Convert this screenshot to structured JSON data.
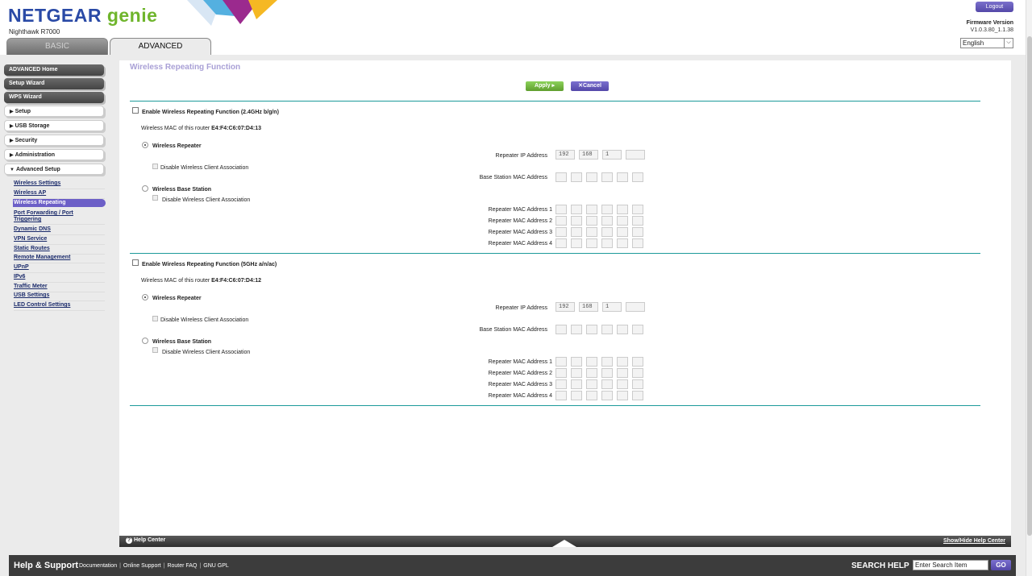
{
  "header": {
    "logo_brand": "NETGEAR",
    "logo_product": "genie",
    "model": "Nighthawk R7000",
    "tabs": {
      "basic": "BASIC",
      "advanced": "ADVANCED"
    },
    "logout_label": "Logout",
    "firmware_label": "Firmware Version",
    "firmware_value": "V1.0.3.80_1.1.38",
    "language_selected": "English"
  },
  "sidebar": {
    "buttons": {
      "advanced_home": "ADVANCED Home",
      "setup_wizard": "Setup Wizard",
      "wps_wizard": "WPS Wizard"
    },
    "sections": {
      "setup": "Setup",
      "usb_storage": "USB Storage",
      "security": "Security",
      "administration": "Administration",
      "advanced_setup": "Advanced Setup"
    },
    "sub_items": {
      "wireless_settings": "Wireless Settings",
      "wireless_ap": "Wireless AP",
      "wireless_repeating": "Wireless Repeating",
      "port_forwarding_1": "Port Forwarding / Port",
      "port_forwarding_2": "Triggering",
      "dynamic_dns": "Dynamic DNS",
      "vpn_service": "VPN Service",
      "static_routes": "Static Routes",
      "remote_management": "Remote Management",
      "upnp": "UPnP",
      "ipv6": "IPv6",
      "traffic_meter": "Traffic Meter",
      "usb_settings": "USB Settings",
      "led_control": "LED Control Settings"
    }
  },
  "main": {
    "title": "Wireless Repeating Function",
    "apply_label": "Apply",
    "apply_arrow": "▸",
    "cancel_icon": "✕",
    "cancel_label": "Cancel",
    "band24": {
      "enable_label": "Enable Wireless Repeating Function (2.4GHz b/g/n)",
      "mac_label": "Wireless MAC of this router",
      "mac_value": "E4:F4:C6:07:D4:13",
      "repeater_label": "Wireless Repeater",
      "disable_assoc_label": "Disable Wireless Client Association",
      "base_station_label": "Wireless Base Station",
      "disable_assoc_label2": "Disable Wireless Client Association",
      "repeater_ip_label": "Repeater IP Address",
      "ip": [
        "192",
        "168",
        "1",
        ""
      ],
      "base_mac_label": "Base Station MAC Address",
      "rep_mac_labels": [
        "Repeater MAC Address 1",
        "Repeater MAC Address 2",
        "Repeater MAC Address 3",
        "Repeater MAC Address 4"
      ]
    },
    "band5": {
      "enable_label": "Enable Wireless Repeating Function (5GHz a/n/ac)",
      "mac_label": "Wireless MAC of this router",
      "mac_value": "E4:F4:C6:07:D4:12",
      "repeater_label": "Wireless Repeater",
      "disable_assoc_label": "Disable Wireless Client Association",
      "base_station_label": "Wireless Base Station",
      "disable_assoc_label2": "Disable Wireless Client Association",
      "repeater_ip_label": "Repeater IP Address",
      "ip": [
        "192",
        "168",
        "1",
        ""
      ],
      "base_mac_label": "Base Station MAC Address",
      "rep_mac_labels": [
        "Repeater MAC Address 1",
        "Repeater MAC Address 2",
        "Repeater MAC Address 3",
        "Repeater MAC Address 4"
      ]
    }
  },
  "help_bar": {
    "help_icon": "?",
    "help_center": "Help Center",
    "show_hide": "Show/Hide Help Center"
  },
  "footer": {
    "title": "Help & Support",
    "links": [
      "Documentation",
      "Online Support",
      "Router FAQ",
      "GNU GPL"
    ],
    "search_label": "SEARCH HELP",
    "search_placeholder": "Enter Search Item",
    "go_label": "GO"
  },
  "colors": {
    "accent_purple": "#6c5fc7",
    "apply_green": "#6fb52c",
    "divider_teal": "#1d9a9a",
    "brand_blue": "#2a4aa6"
  }
}
